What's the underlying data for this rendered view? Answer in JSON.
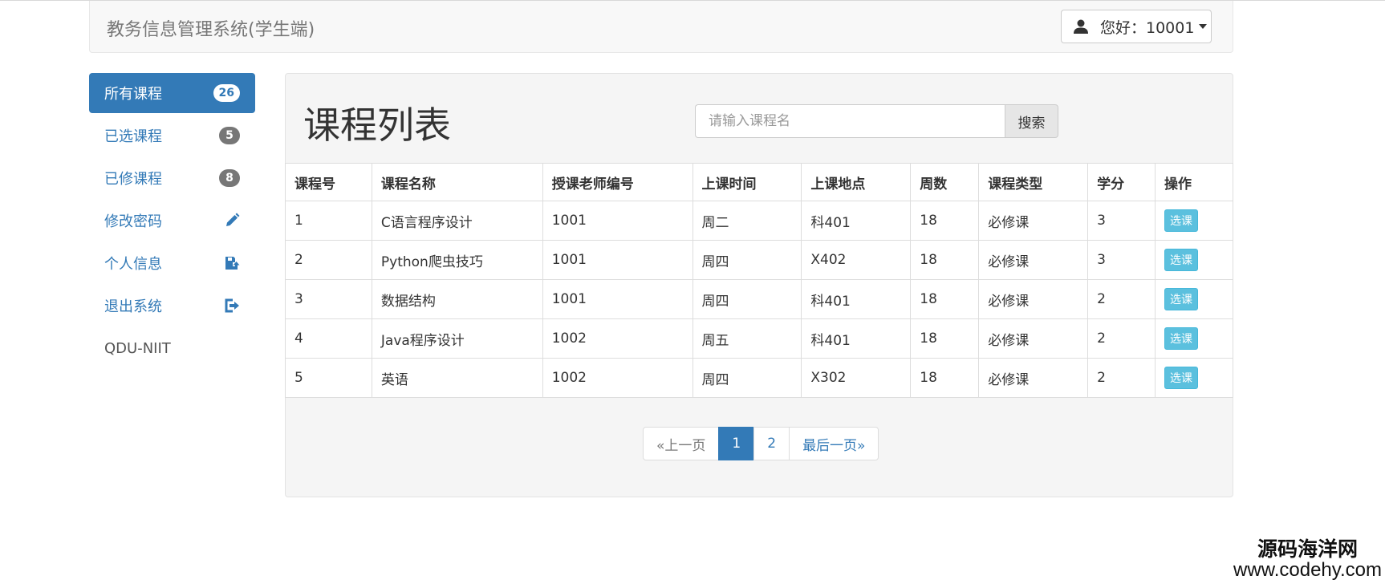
{
  "navbar": {
    "brand": "教务信息管理系统(学生端)",
    "greeting": "您好：10001"
  },
  "sidebar": {
    "items": [
      {
        "label": "所有课程",
        "badge": "26"
      },
      {
        "label": "已选课程",
        "badge": "5"
      },
      {
        "label": "已修课程",
        "badge": "8"
      },
      {
        "label": "修改密码",
        "icon": "pencil-icon"
      },
      {
        "label": "个人信息",
        "icon": "floppy-upload-icon"
      },
      {
        "label": "退出系统",
        "icon": "logout-icon"
      }
    ],
    "footer": "QDU-NIIT"
  },
  "main": {
    "title": "课程列表",
    "search": {
      "placeholder": "请输入课程名",
      "button": "搜索"
    },
    "table": {
      "headers": [
        "课程号",
        "课程名称",
        "授课老师编号",
        "上课时间",
        "上课地点",
        "周数",
        "课程类型",
        "学分",
        "操作"
      ],
      "action_label": "选课",
      "rows": [
        [
          "1",
          "C语言程序设计",
          "1001",
          "周二",
          "科401",
          "18",
          "必修课",
          "3"
        ],
        [
          "2",
          "Python爬虫技巧",
          "1001",
          "周四",
          "X402",
          "18",
          "必修课",
          "3"
        ],
        [
          "3",
          "数据结构",
          "1001",
          "周四",
          "科401",
          "18",
          "必修课",
          "2"
        ],
        [
          "4",
          "Java程序设计",
          "1002",
          "周五",
          "科401",
          "18",
          "必修课",
          "2"
        ],
        [
          "5",
          "英语",
          "1002",
          "周四",
          "X302",
          "18",
          "必修课",
          "2"
        ]
      ]
    },
    "pagination": {
      "prev": "«上一页",
      "pages": [
        "1",
        "2"
      ],
      "current": "1",
      "last": "最后一页»"
    }
  },
  "watermark": {
    "cn": "源码海洋网",
    "url": "www.codehy.com"
  },
  "colors": {
    "primary": "#337ab7",
    "info": "#5bc0de",
    "badge": "#777777",
    "panel_bg": "#f5f5f5"
  }
}
